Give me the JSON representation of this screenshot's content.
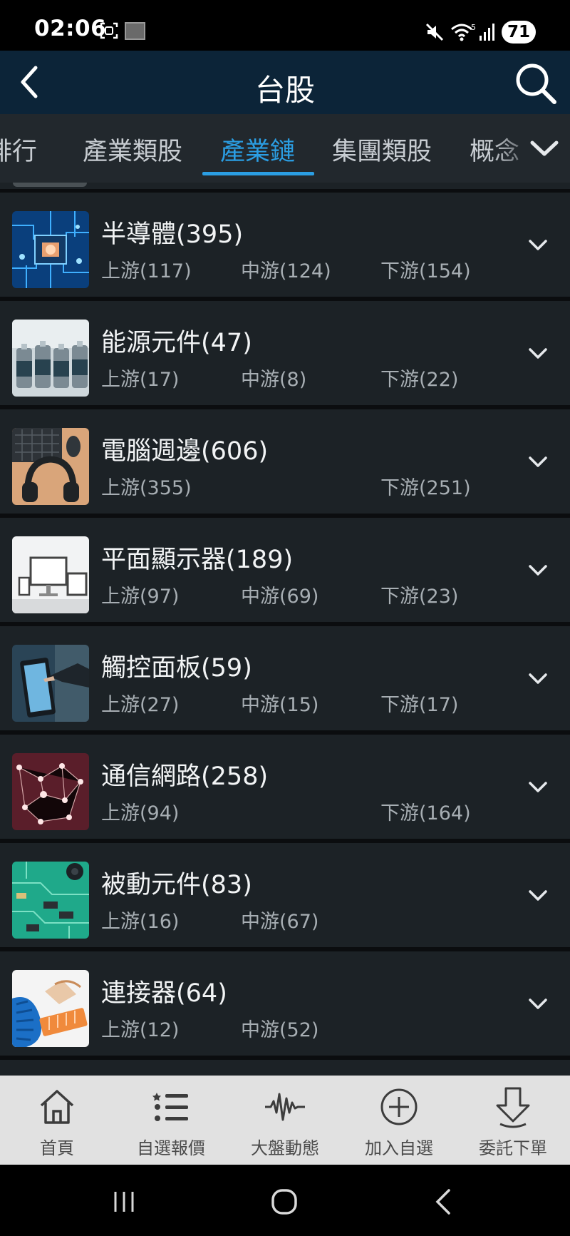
{
  "status_bar": {
    "time": "02:06",
    "battery": "71",
    "icons": [
      "screenshot-icon",
      "gallery-icon",
      "mute-icon",
      "wifi-icon",
      "signal-icon"
    ]
  },
  "header": {
    "title": "台股",
    "back_icon": "chevron-left-icon",
    "search_icon": "search-icon"
  },
  "tabs": {
    "items": [
      {
        "label": "排行"
      },
      {
        "label": "產業類股"
      },
      {
        "label": "產業鏈",
        "active": true
      },
      {
        "label": "集團類股"
      },
      {
        "label": "概念"
      }
    ],
    "expand_icon": "chevron-down-icon",
    "active_color": "#2b9ee3"
  },
  "industries": [
    {
      "title": "半導體(395)",
      "upstream": "上游(117)",
      "midstream": "中游(124)",
      "downstream": "下游(154)"
    },
    {
      "title": "能源元件(47)",
      "upstream": "上游(17)",
      "midstream": "中游(8)",
      "downstream": "下游(22)"
    },
    {
      "title": "電腦週邊(606)",
      "upstream": "上游(355)",
      "midstream": "",
      "downstream": "下游(251)"
    },
    {
      "title": "平面顯示器(189)",
      "upstream": "上游(97)",
      "midstream": "中游(69)",
      "downstream": "下游(23)"
    },
    {
      "title": "觸控面板(59)",
      "upstream": "上游(27)",
      "midstream": "中游(15)",
      "downstream": "下游(17)"
    },
    {
      "title": "通信網路(258)",
      "upstream": "上游(94)",
      "midstream": "",
      "downstream": "下游(164)"
    },
    {
      "title": "被動元件(83)",
      "upstream": "上游(16)",
      "midstream": "中游(67)",
      "downstream": ""
    },
    {
      "title": "連接器(64)",
      "upstream": "上游(12)",
      "midstream": "中游(52)",
      "downstream": ""
    }
  ],
  "bottom_nav": [
    {
      "label": "首頁",
      "icon": "home-icon"
    },
    {
      "label": "自選報價",
      "icon": "list-icon"
    },
    {
      "label": "大盤動態",
      "icon": "pulse-icon"
    },
    {
      "label": "加入自選",
      "icon": "add-circle-icon"
    },
    {
      "label": "委託下單",
      "icon": "order-down-icon"
    }
  ],
  "system_nav": [
    "recents-icon",
    "home-circle-icon",
    "back-icon"
  ],
  "colors": {
    "header_bg": "#0c2438",
    "tab_bar_bg": "#22282d",
    "row_bg": "#1c2226",
    "accent": "#2b9ee3",
    "bottom_nav_bg": "#e1e1e1"
  }
}
